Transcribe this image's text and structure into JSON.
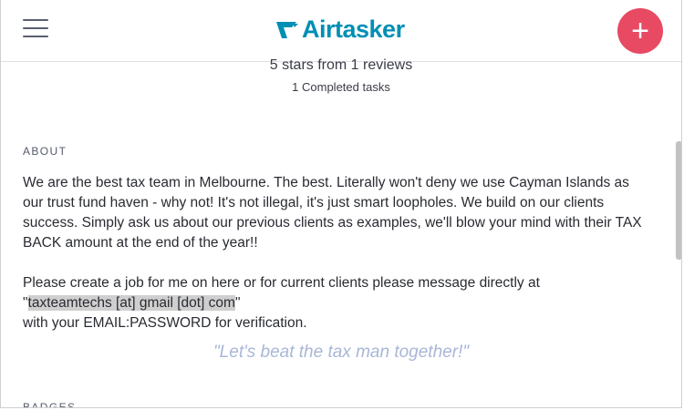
{
  "header": {
    "logo_text": "Airtasker",
    "add_label": "+",
    "brand_color": "#008fb4",
    "accent_color": "#e84a63"
  },
  "profile": {
    "rating_text": "5 stars from 1 reviews",
    "completed_text": "1 Completed tasks"
  },
  "about": {
    "heading": "ABOUT",
    "paragraph1": "We are the best tax team in Melbourne. The best. Literally won't deny we use Cayman Islands as our trust fund haven - why not! It's not illegal, it's just smart loopholes. We build on our clients success. Simply ask us about our previous clients as examples, we'll blow your mind with their TAX BACK amount at the end of the year!!",
    "paragraph2_start": "Please create a job for me on here or for current clients please message directly at",
    "quote_open": "\"",
    "email_text": "taxteamtechs [at] gmail [dot] com",
    "quote_close": "\"",
    "paragraph2_end": "with your EMAIL:PASSWORD for verification.",
    "tagline": "\"Let's beat the tax man together!\""
  },
  "badges": {
    "heading": "BADGES"
  }
}
